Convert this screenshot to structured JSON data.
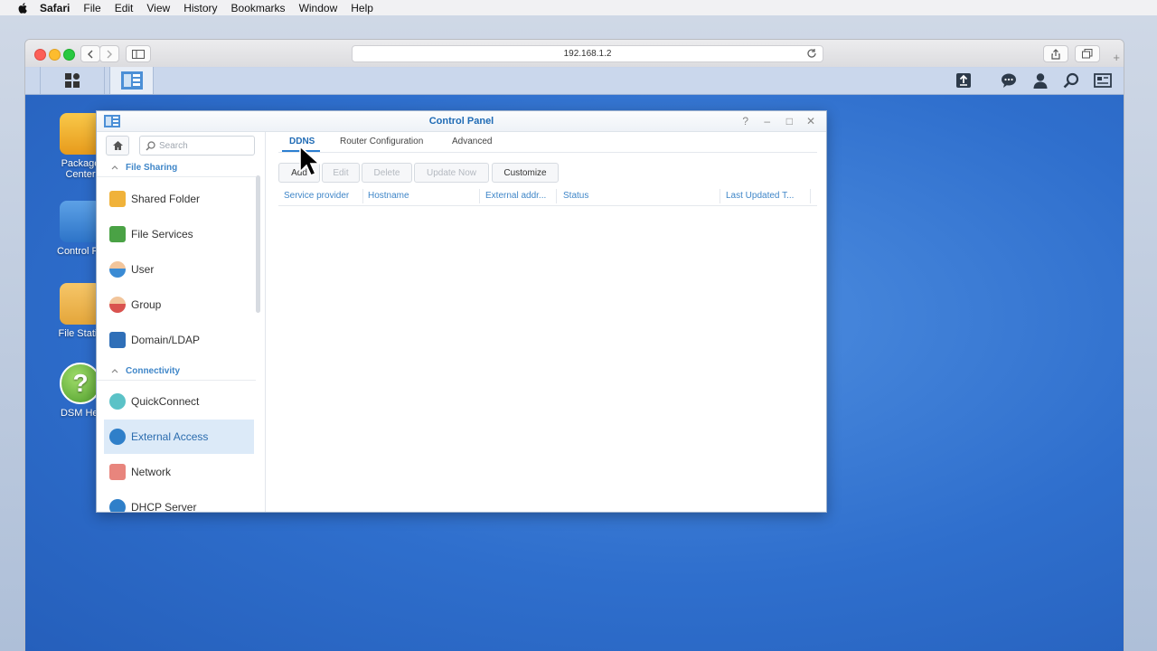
{
  "menubar": {
    "app": "Safari",
    "items": [
      "File",
      "Edit",
      "View",
      "History",
      "Bookmarks",
      "Window",
      "Help"
    ]
  },
  "browser": {
    "url": "192.168.1.2"
  },
  "desktop_icons": [
    {
      "label": "Package\nCenter"
    },
    {
      "label": "Control Pa"
    },
    {
      "label": "File Statio"
    },
    {
      "label": "DSM Hel"
    }
  ],
  "control_panel": {
    "title": "Control Panel",
    "search_placeholder": "Search",
    "sections": {
      "file_sharing": "File Sharing",
      "connectivity": "Connectivity"
    },
    "nav": {
      "shared_folder": "Shared Folder",
      "file_services": "File Services",
      "user": "User",
      "group": "Group",
      "domain_ldap": "Domain/LDAP",
      "quickconnect": "QuickConnect",
      "external_access": "External Access",
      "network": "Network",
      "dhcp_server": "DHCP Server"
    },
    "tabs": {
      "ddns": "DDNS",
      "router": "Router Configuration",
      "advanced": "Advanced"
    },
    "buttons": {
      "add": "Add",
      "edit": "Edit",
      "delete": "Delete",
      "update_now": "Update Now",
      "customize": "Customize"
    },
    "columns": {
      "provider": "Service provider",
      "hostname": "Hostname",
      "external": "External addr...",
      "status": "Status",
      "last_updated": "Last Updated T..."
    }
  },
  "colors": {
    "dsm_blue": "#2f6fcd",
    "accent": "#1f6bb5",
    "active_bg": "#dceaf8"
  }
}
